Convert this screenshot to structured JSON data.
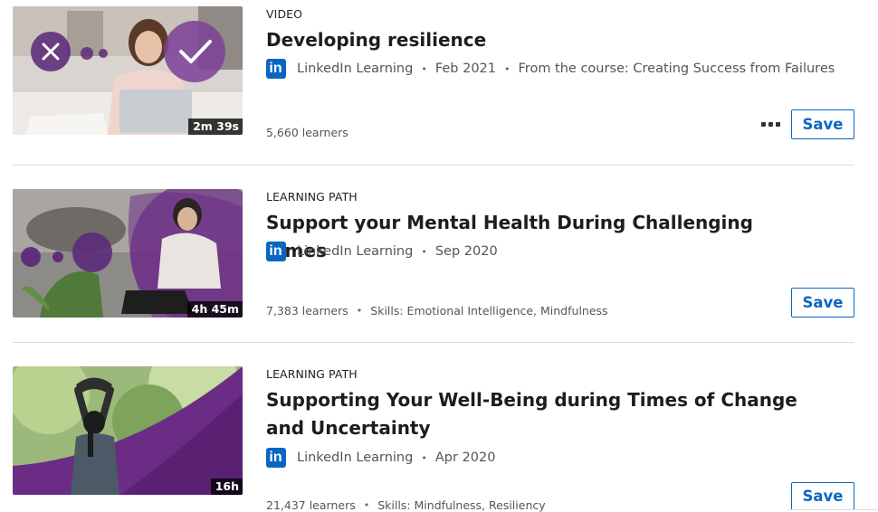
{
  "items": [
    {
      "type": "VIDEO",
      "title": "Developing resilience",
      "provider": "LinkedIn Learning",
      "provider_icon": "linkedin-icon",
      "provider_logo_text": "in",
      "date": "Feb 2021",
      "course_note": "From the course: Creating Success from Failures",
      "duration": "2m 39s",
      "learners": "5,660 learners",
      "more_icon": "more-options-icon",
      "save_label": "Save"
    },
    {
      "type": "LEARNING PATH",
      "title": "Support your Mental Health During Challenging Times",
      "provider": "LinkedIn Learning",
      "provider_icon": "linkedin-icon",
      "provider_logo_text": "in",
      "date": "Sep 2020",
      "duration": "4h 45m",
      "learners": "7,383 learners",
      "skills": "Skills: Emotional Intelligence, Mindfulness",
      "save_label": "Save"
    },
    {
      "type": "LEARNING PATH",
      "title": "Supporting Your Well-Being during Times of Change and Uncertainty",
      "provider": "LinkedIn Learning",
      "provider_icon": "linkedin-icon",
      "provider_logo_text": "in",
      "date": "Apr 2020",
      "duration": "16h",
      "learners": "21,437 learners",
      "skills": "Skills: Mindfulness, Resiliency",
      "save_label": "Save"
    }
  ],
  "colors": {
    "linkedin_blue": "#0a66c2",
    "accent_purple": "#6b2c86",
    "divider": "#dcdcdc"
  }
}
